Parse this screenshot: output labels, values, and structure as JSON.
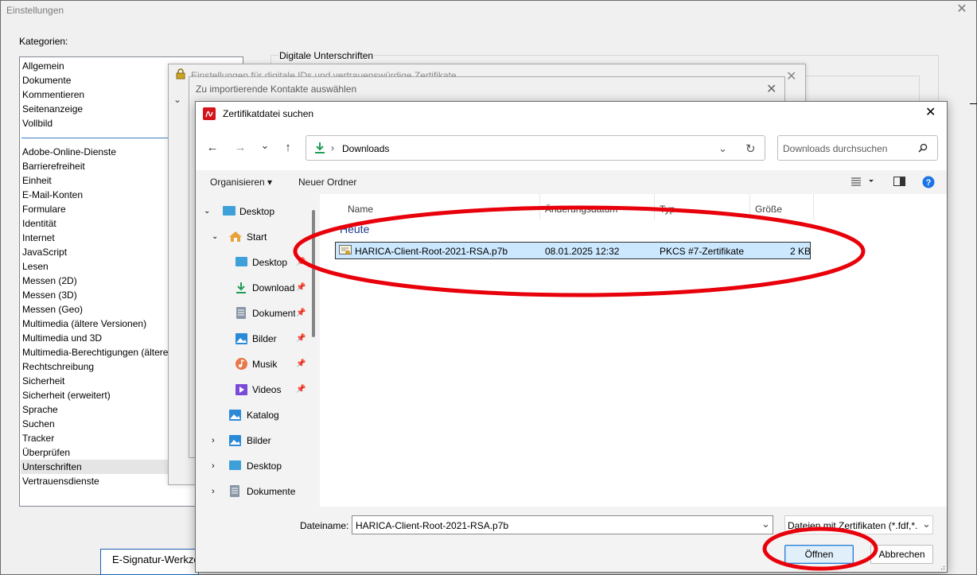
{
  "settings": {
    "title": "Einstellungen",
    "close": "✕",
    "categories_label": "Kategorien:",
    "categories_top": [
      "Allgemein",
      "Dokumente",
      "Kommentieren",
      "Seitenanzeige",
      "Vollbild"
    ],
    "categories_bottom": [
      "Adobe-Online-Dienste",
      "Barrierefreiheit",
      "Einheit",
      "E-Mail-Konten",
      "Formulare",
      "Identität",
      "Internet",
      "JavaScript",
      "Lesen",
      "Messen (2D)",
      "Messen (3D)",
      "Messen (Geo)",
      "Multimedia (ältere Versionen)",
      "Multimedia und 3D",
      "Multimedia-Berechtigungen (ältere",
      "Rechtschreibung",
      "Sicherheit",
      "Sicherheit (erweitert)",
      "Sprache",
      "Suchen",
      "Tracker",
      "Überprüfen",
      "Unterschriften",
      "Vertrauensdienste"
    ],
    "selected_category": "Unterschriften",
    "signature_group_label": "Digitale Unterschriften",
    "taskbar_item": "E-Signatur-Werkze"
  },
  "dialog_trusted": {
    "title": "Einstellungen für digitale IDs und vertrauenswürdige Zertifikate",
    "close": "✕"
  },
  "dialog_contacts": {
    "title": "Zu importierende Kontakte auswählen",
    "close": "✕",
    "chevron": "⌄"
  },
  "file_dialog": {
    "title": "Zertifikatdatei suchen",
    "close": "✕",
    "nav": {
      "back": "←",
      "forward": "→",
      "recent": "⌄",
      "up": "↑"
    },
    "address": {
      "separator": "›",
      "location": "Downloads"
    },
    "search_placeholder": "Downloads durchsuchen",
    "toolbar": {
      "organize": "Organisieren ▾",
      "new_folder": "Neuer Ordner"
    },
    "nav_pane": {
      "desktop_root": "Desktop",
      "start": "Start",
      "quick_access": [
        "Desktop",
        "Downloads",
        "Dokumente",
        "Bilder",
        "Musik",
        "Videos"
      ],
      "gallery": "Katalog",
      "libraries": [
        "Bilder",
        "Desktop",
        "Dokumente"
      ]
    },
    "columns": {
      "name": "Name",
      "date": "Änderungsdatum",
      "type": "Typ",
      "size": "Größe"
    },
    "group": "Heute",
    "files": [
      {
        "name": "HARICA-Client-Root-2021-RSA.p7b",
        "date": "08.01.2025 12:32",
        "type": "PKCS #7-Zertifikate",
        "size": "2 KB"
      }
    ],
    "filename_label": "Dateiname:",
    "filename_value": "HARICA-Client-Root-2021-RSA.p7b",
    "filetype_value": "Dateien mit Zertifikaten (*.fdf,*.",
    "open_button": "Öffnen",
    "cancel_button": "Abbrechen"
  },
  "colors": {
    "selection": "#cce8ff",
    "annotation": "#e8000b",
    "accent": "#0067c0"
  }
}
